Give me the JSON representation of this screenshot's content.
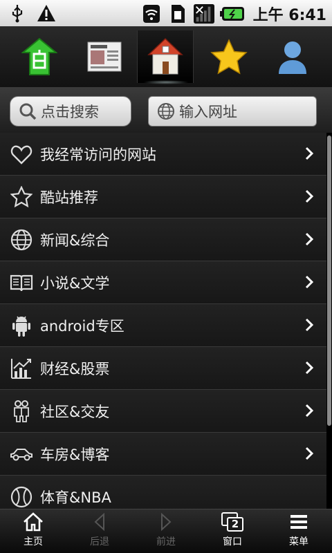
{
  "status_bar": {
    "time": "上午 6:41"
  },
  "top_tabs": [
    {
      "name": "home-tab",
      "icon": "green-building-icon"
    },
    {
      "name": "news-tab",
      "icon": "newspaper-icon"
    },
    {
      "name": "house-tab",
      "icon": "house-icon",
      "active": true
    },
    {
      "name": "favorites-tab",
      "icon": "star-icon"
    },
    {
      "name": "user-tab",
      "icon": "user-icon"
    }
  ],
  "search": {
    "placeholder": "点击搜索",
    "url_placeholder": "输入网址"
  },
  "categories": [
    {
      "label": "我经常访问的网站",
      "icon": "heart-icon"
    },
    {
      "label": "酷站推荐",
      "icon": "star-icon"
    },
    {
      "label": "新闻&综合",
      "icon": "globe-icon"
    },
    {
      "label": "小说&文学",
      "icon": "book-icon"
    },
    {
      "label": "android专区",
      "icon": "android-icon"
    },
    {
      "label": "财经&股票",
      "icon": "chart-icon"
    },
    {
      "label": "社区&交友",
      "icon": "people-icon"
    },
    {
      "label": "车房&博客",
      "icon": "car-icon"
    },
    {
      "label": "体育&NBA",
      "icon": "ball-icon"
    }
  ],
  "bottom_bar": {
    "home": "主页",
    "back": "后退",
    "forward": "前进",
    "window": "窗口",
    "window_count": "2",
    "menu": "菜单"
  }
}
